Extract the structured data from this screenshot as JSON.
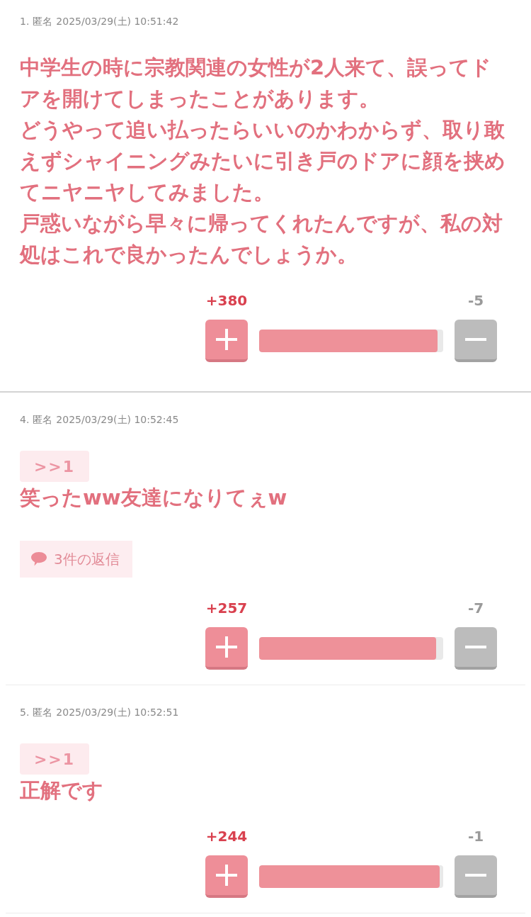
{
  "posts": [
    {
      "kind": "topic",
      "number": "1.",
      "author": "匿名",
      "date": "2025/03/29(土) 10:51:42",
      "paragraphs": [
        "中学生の時に宗教関連の女性が2人来て、誤ってドアを開けてしまったことがあります。",
        "どうやって追い払ったらいいのかわからず、取り敢えずシャイニングみたいに引き戸のドアに顔を挟めてニヤニヤしてみました。",
        "戸惑いながら早々に帰ってくれたんですが、私の対処はこれで良かったんでしょうか。"
      ],
      "votes": {
        "plus": "+380",
        "minus": "-5",
        "level": 0.97
      }
    },
    {
      "kind": "comment",
      "number": "4.",
      "author": "匿名",
      "date": "2025/03/29(土) 10:52:45",
      "anchor": ">>1",
      "paragraphs": [
        "笑ったww友達になりてぇw"
      ],
      "replies": "3件の返信",
      "votes": {
        "plus": "+257",
        "minus": "-7",
        "level": 0.96
      }
    },
    {
      "kind": "comment",
      "number": "5.",
      "author": "匿名",
      "date": "2025/03/29(土) 10:52:51",
      "anchor": ">>1",
      "paragraphs": [
        "正解です"
      ],
      "votes": {
        "plus": "+244",
        "minus": "-1",
        "level": 0.98
      }
    }
  ]
}
